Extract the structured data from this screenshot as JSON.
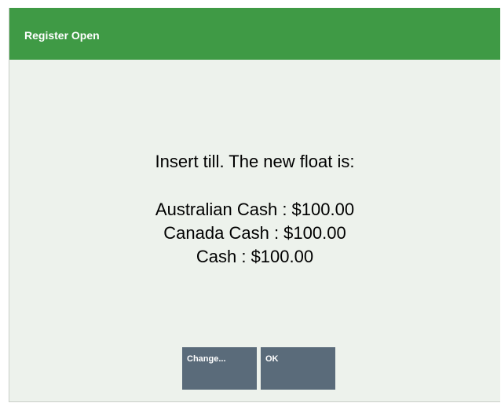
{
  "dialog": {
    "title": "Register Open",
    "message": {
      "heading": "Insert till. The new float is:",
      "lines": [
        "Australian Cash : $100.00",
        "Canada Cash : $100.00",
        "Cash : $100.00"
      ]
    },
    "buttons": {
      "change_label": "Change...",
      "ok_label": "OK"
    }
  },
  "colors": {
    "title_bar": "#3f9a45",
    "background": "#edf2ec",
    "button": "#5a6b7a"
  }
}
